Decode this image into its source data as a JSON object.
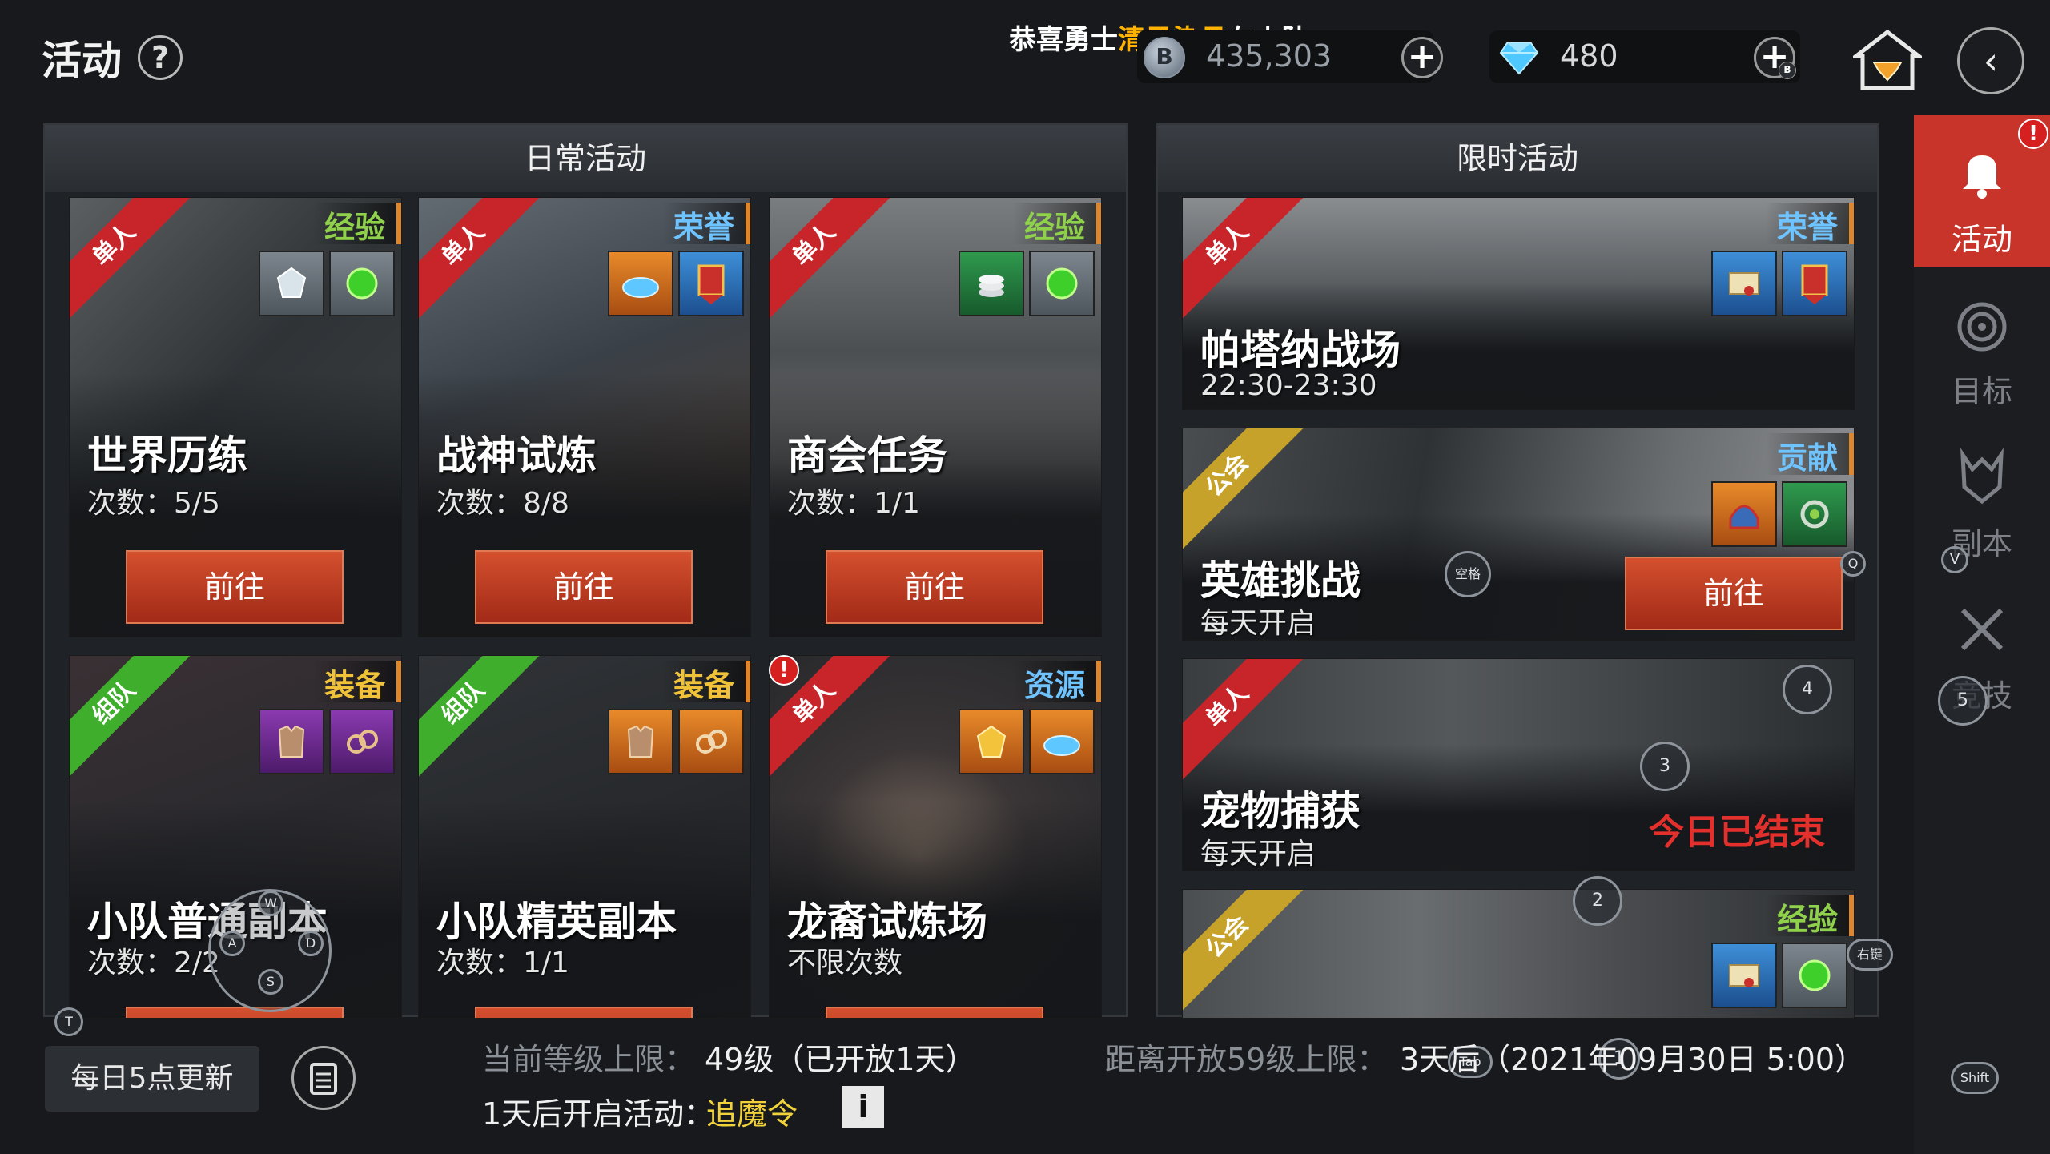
{
  "header": {
    "title": "活动",
    "help": "?",
    "ticker_prefix": "恭喜勇士",
    "ticker_name": "清风染月",
    "ticker_suffix": "在小队",
    "coin_icon": "B",
    "coin_value": "435,303",
    "gem_value": "480",
    "plus": "+",
    "plus_gem_badge": "B",
    "back_icon": "‹"
  },
  "daily_panel": {
    "title": "日常活动",
    "cards": [
      {
        "ribbon": "单人",
        "tag": "经验",
        "name": "世界历练",
        "sub": "次数：5/5",
        "button": "前往"
      },
      {
        "ribbon": "单人",
        "tag": "荣誉",
        "name": "战神试炼",
        "sub": "次数：8/8",
        "button": "前往"
      },
      {
        "ribbon": "单人",
        "tag": "经验",
        "name": "商会任务",
        "sub": "次数：1/1",
        "button": "前往"
      },
      {
        "ribbon": "组队",
        "tag": "装备",
        "name": "小队普通副本",
        "sub": "次数：2/2"
      },
      {
        "ribbon": "组队",
        "tag": "装备",
        "name": "小队精英副本",
        "sub": "次数：1/1"
      },
      {
        "ribbon": "单人",
        "tag": "资源",
        "name": "龙裔试炼场",
        "sub": "不限次数",
        "alert": "!"
      }
    ]
  },
  "limited_panel": {
    "title": "限时活动",
    "cards": [
      {
        "ribbon": "单人",
        "tag": "荣誉",
        "name": "帕塔纳战场",
        "sub": "22:30-23:30"
      },
      {
        "ribbon": "公会",
        "tag": "贡献",
        "name": "英雄挑战",
        "sub": "每天开启",
        "button": "前往"
      },
      {
        "ribbon": "单人",
        "name": "宠物捕获",
        "sub": "每天开启",
        "status": "今日已结束"
      },
      {
        "ribbon": "公会",
        "tag": "经验"
      }
    ]
  },
  "sidebar": {
    "alert": "!",
    "items": [
      {
        "label": "活动",
        "icon": "bell-icon"
      },
      {
        "label": "目标",
        "icon": "target-icon"
      },
      {
        "label": "副本",
        "icon": "dungeon-icon"
      },
      {
        "label": "竞技",
        "icon": "crossed-axes-icon"
      }
    ]
  },
  "key_hints": {
    "space": "空格",
    "q": "Q",
    "w": "W",
    "a": "A",
    "s": "S",
    "d": "D",
    "t": "T",
    "v": "V",
    "n5": "5",
    "n4": "4",
    "n3": "3",
    "n2": "2",
    "n1": "1",
    "right": "右键",
    "tab": "Tab",
    "shift": "Shift"
  },
  "footer": {
    "daily_update": "每日5点更新",
    "level_cap_label": "当前等级上限：",
    "level_cap_value": "49级（已开放1天）",
    "next_cap_label": "距离开放59级上限：",
    "next_cap_value": "3天后（2021年09月30日 5:00）",
    "upcoming_label": "1天后开启活动：",
    "upcoming_value": "追魔令",
    "info": "i"
  },
  "colors": {
    "accent_red": "#c8342a",
    "go_button": "#b93a20",
    "tag_gold": "#f0c23a",
    "tag_green": "#8fd14a",
    "tag_blue": "#6fc3ff",
    "ended_red": "#e3302c",
    "upcoming_yellow": "#f1d23b"
  }
}
